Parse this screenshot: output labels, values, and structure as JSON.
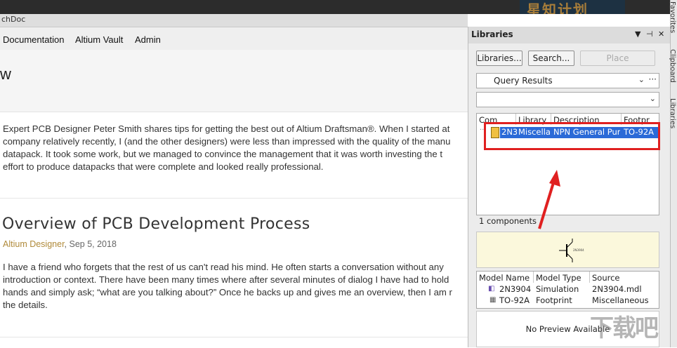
{
  "background_window": {
    "banner_text": "星知计划"
  },
  "browser": {
    "tab_title": "chDoc",
    "nav": [
      "Documentation",
      "Altium Vault",
      "Admin"
    ],
    "page_heading": "w",
    "intro_lines": [
      "Expert PCB Designer Peter Smith shares tips for getting the best out of Altium Draftsman®. When I started at",
      "company relatively recently, I (and the other designers) were less than impressed with the quality of the manu",
      "datapack. It took some work, but we managed to convince the management that it was worth investing the t",
      "effort to produce datapacks that were complete and looked really professional."
    ],
    "article": {
      "title": "Overview of PCB Development Process",
      "category": "Altium Designer",
      "date": ", Sep 5, 2018",
      "lines": [
        "I have a friend who forgets that the rest of us can't read his mind. He often starts a conversation without any",
        "introduction or context. There have been many times where after several minutes of dialog I have had to hold",
        "hands and simply ask; “what are you talking about?” Once he backs up and gives me an overview, then I am r",
        "the details."
      ]
    }
  },
  "libraries": {
    "title": "Libraries",
    "header_controls": [
      "▼",
      "⊣",
      "✕"
    ],
    "buttons": {
      "libraries": "Libraries...",
      "search": "Search...",
      "place": "Place"
    },
    "query_combo": "Query Results",
    "query_more": "···",
    "filter_combo": "",
    "columns": [
      "Com",
      "Library",
      "Description",
      "Footpr"
    ],
    "selected_row": {
      "component": "2N3",
      "library": "Miscellar",
      "description": "NPN General Purpo",
      "footprint": "TO-92A"
    },
    "count_text": "1 components",
    "model_columns": [
      "Model Name",
      "Model Type",
      "Source"
    ],
    "models": [
      {
        "name": "2N3904",
        "type": "Simulation",
        "source": "2N3904.mdl"
      },
      {
        "name": "TO-92A",
        "type": "Footprint",
        "source": "Miscellaneous"
      }
    ],
    "no_preview": "No Preview Available",
    "preview_label": "2N3904"
  },
  "side_tabs": [
    "Favorites",
    "Clipboard",
    "Libraries"
  ],
  "watermark": "下载吧",
  "colors": {
    "selection": "#2b6ad7",
    "highlight_box": "#e02020",
    "category_link": "#b08a3a"
  }
}
